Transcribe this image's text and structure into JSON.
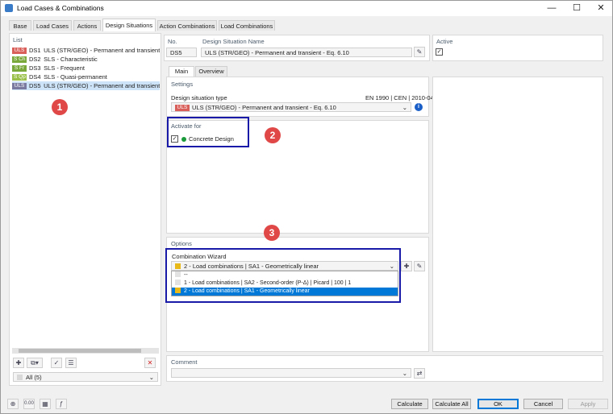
{
  "window": {
    "title": "Load Cases & Combinations",
    "minimize": "—",
    "maximize": "☐",
    "close": "✕"
  },
  "tabs": [
    "Base",
    "Load Cases",
    "Actions",
    "Design Situations",
    "Action Combinations",
    "Load Combinations"
  ],
  "list": {
    "header": "List",
    "items": [
      {
        "badge": "ULS",
        "badge_color": "#d9605a",
        "code": "DS1",
        "text": "ULS (STR/GEO) - Permanent and transient - E"
      },
      {
        "badge": "S Ch",
        "badge_color": "#7aa83a",
        "code": "DS2",
        "text": "SLS - Characteristic"
      },
      {
        "badge": "S Fr",
        "badge_color": "#7aa83a",
        "code": "DS3",
        "text": "SLS - Frequent"
      },
      {
        "badge": "S Qp",
        "badge_color": "#9bc04a",
        "code": "DS4",
        "text": "SLS - Quasi-permanent"
      },
      {
        "badge": "ULS",
        "badge_color": "#7a7aa0",
        "code": "DS5",
        "text": "ULS (STR/GEO) - Permanent and transient - E"
      }
    ],
    "filter": "All (5)"
  },
  "header": {
    "no_label": "No.",
    "no_value": "DS5",
    "name_label": "Design Situation Name",
    "name_value": "ULS (STR/GEO) - Permanent and transient - Eq. 6.10",
    "active_label": "Active"
  },
  "subtabs": [
    "Main",
    "Overview"
  ],
  "settings": {
    "title": "Settings",
    "type_label": "Design situation type",
    "standard": "EN 1990 | CEN | 2010-04",
    "type_badge": "ULS",
    "type_value": "ULS (STR/GEO) - Permanent and transient - Eq. 6.10"
  },
  "activate": {
    "title": "Activate for",
    "item": "Concrete Design"
  },
  "options": {
    "title": "Options",
    "wizard_label": "Combination Wizard",
    "wizard_value": "2 - Load combinations | SA1 - Geometrically linear",
    "dropdown": [
      "--",
      "1 - Load combinations | SA2 - Second-order (P-Δ) | Picard | 100 | 1",
      "2 - Load combinations | SA1 - Geometrically linear"
    ]
  },
  "comment": {
    "title": "Comment"
  },
  "callouts": [
    "1",
    "2",
    "3"
  ],
  "buttons": {
    "calculate": "Calculate",
    "calculate_all": "Calculate All",
    "ok": "OK",
    "cancel": "Cancel",
    "apply": "Apply"
  },
  "colors": {
    "callout": "#e04848",
    "highlight": "#1a1aa8",
    "selection": "#0078d7"
  }
}
